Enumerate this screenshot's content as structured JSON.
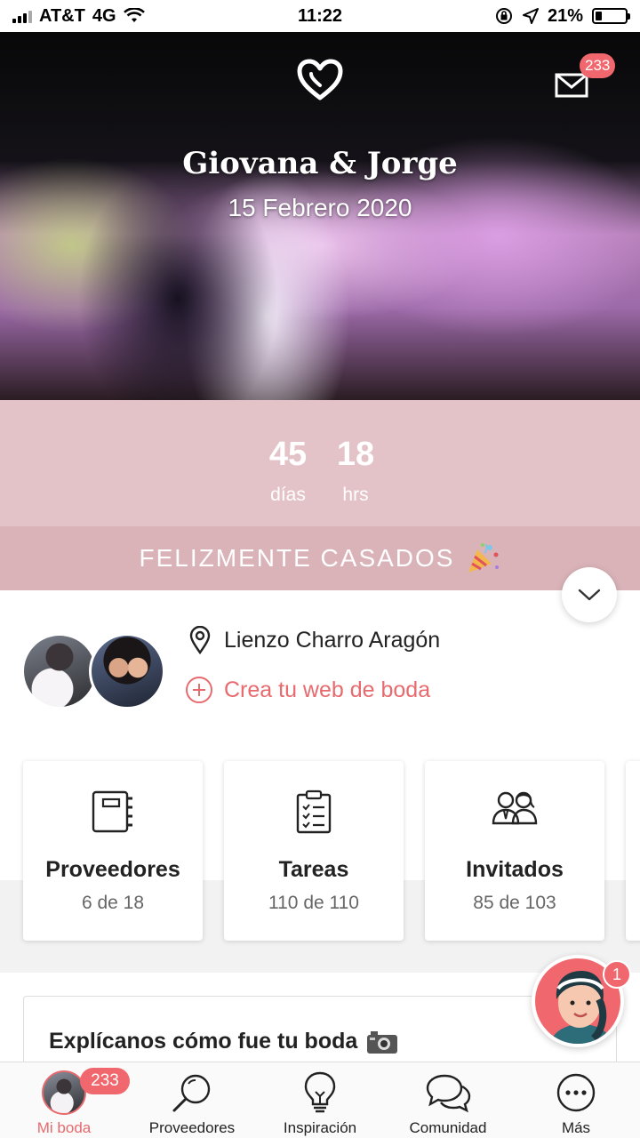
{
  "status_bar": {
    "carrier": "AT&T",
    "network": "4G",
    "time": "11:22",
    "battery_percent": "21%",
    "battery_level": 0.21
  },
  "hero": {
    "couple_names": "Giovana & Jorge",
    "wedding_date": "15 Febrero 2020",
    "mail_badge_count": "233",
    "heart_icon": "heart-logo-icon",
    "mail_icon": "envelope-icon"
  },
  "countdown": {
    "days_value": "45",
    "days_label": "días",
    "hours_value": "18",
    "hours_label": "hrs"
  },
  "status_banner": {
    "text": "FELIZMENTE CASADOS",
    "icon": "party-popper-icon"
  },
  "wedding_info": {
    "venue": "Lienzo Charro Aragón",
    "create_web_label": "Crea tu web de boda"
  },
  "summary_cards": [
    {
      "title": "Proveedores",
      "count": "6 de 18",
      "icon": "notebook-icon"
    },
    {
      "title": "Tareas",
      "count": "110 de 110",
      "icon": "checklist-icon"
    },
    {
      "title": "Invitados",
      "count": "85 de 103",
      "icon": "guests-icon"
    }
  ],
  "review": {
    "title": "Explícanos cómo fue tu boda"
  },
  "assistant": {
    "badge": "1"
  },
  "bottom_nav": {
    "items": [
      {
        "label": "Mi boda",
        "badge": "233",
        "active": true
      },
      {
        "label": "Proveedores",
        "icon": "search-icon"
      },
      {
        "label": "Inspiración",
        "icon": "lightbulb-icon"
      },
      {
        "label": "Comunidad",
        "icon": "chat-bubbles-icon"
      },
      {
        "label": "Más",
        "icon": "more-icon"
      }
    ]
  },
  "colors": {
    "accent": "#e76a6e",
    "badge": "#f0676d",
    "countdown_bg": "#e4c3c8",
    "banner_bg": "#d9b3b8"
  }
}
